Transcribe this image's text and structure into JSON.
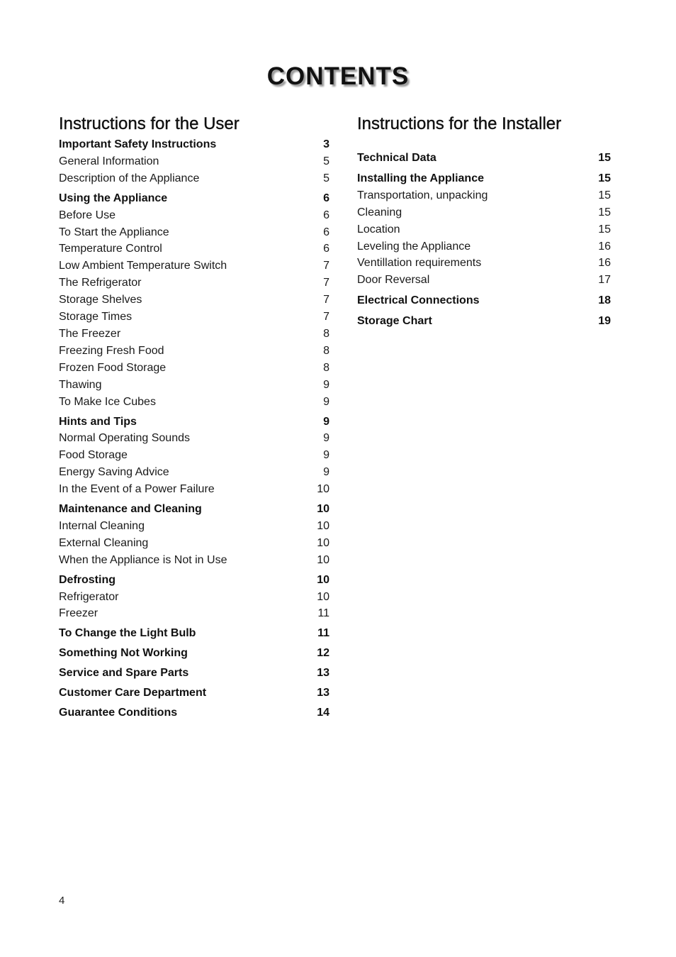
{
  "title": "CONTENTS",
  "user_section": {
    "heading": "Instructions for the User",
    "entries": [
      {
        "label": "Important Safety Instructions",
        "page": "3",
        "bold": true
      },
      {
        "label": "General Information",
        "page": "5",
        "bold": false
      },
      {
        "label": "Description of the Appliance",
        "page": "5",
        "bold": false
      },
      {
        "label": "Using the Appliance",
        "page": "6",
        "bold": true
      },
      {
        "label": "Before Use",
        "page": "6",
        "bold": false
      },
      {
        "label": "To Start the Appliance",
        "page": "6",
        "bold": false
      },
      {
        "label": "Temperature Control",
        "page": "6",
        "bold": false
      },
      {
        "label": "Low Ambient Temperature Switch",
        "page": "7",
        "bold": false
      },
      {
        "label": "The Refrigerator",
        "page": "7",
        "bold": false
      },
      {
        "label": "Storage Shelves",
        "page": "7",
        "bold": false
      },
      {
        "label": "Storage Times",
        "page": "7",
        "bold": false
      },
      {
        "label": "The Freezer",
        "page": "8",
        "bold": false
      },
      {
        "label": "Freezing Fresh Food",
        "page": "8",
        "bold": false
      },
      {
        "label": "Frozen Food Storage",
        "page": "8",
        "bold": false
      },
      {
        "label": "Thawing",
        "page": "9",
        "bold": false
      },
      {
        "label": "To Make Ice Cubes",
        "page": "9",
        "bold": false
      },
      {
        "label": "Hints and Tips",
        "page": "9",
        "bold": true
      },
      {
        "label": "Normal Operating Sounds",
        "page": "9",
        "bold": false
      },
      {
        "label": "Food Storage",
        "page": "9",
        "bold": false
      },
      {
        "label": "Energy Saving Advice",
        "page": "9",
        "bold": false
      },
      {
        "label": "In the Event of a Power Failure",
        "page": "10",
        "bold": false
      },
      {
        "label": "Maintenance and Cleaning",
        "page": "10",
        "bold": true
      },
      {
        "label": "Internal Cleaning",
        "page": "10",
        "bold": false
      },
      {
        "label": "External Cleaning",
        "page": "10",
        "bold": false
      },
      {
        "label": "When the Appliance is Not in Use",
        "page": "10",
        "bold": false
      },
      {
        "label": "Defrosting",
        "page": "10",
        "bold": true
      },
      {
        "label": "Refrigerator",
        "page": "10",
        "bold": false
      },
      {
        "label": "Freezer",
        "page": "11",
        "bold": false
      },
      {
        "label": "To Change the Light Bulb",
        "page": "11",
        "bold": true
      },
      {
        "label": "Something Not Working",
        "page": "12",
        "bold": true
      },
      {
        "label": "Service and Spare Parts",
        "page": "13",
        "bold": true
      },
      {
        "label": "Customer Care Department",
        "page": "13",
        "bold": true
      },
      {
        "label": "Guarantee Conditions",
        "page": "14",
        "bold": true
      }
    ]
  },
  "installer_section": {
    "heading": "Instructions for the Installer",
    "entries": [
      {
        "label": "Technical Data",
        "page": "15",
        "bold": true
      },
      {
        "label": "Installing the Appliance",
        "page": "15",
        "bold": true
      },
      {
        "label": "Transportation, unpacking",
        "page": "15",
        "bold": false
      },
      {
        "label": "Cleaning",
        "page": "15",
        "bold": false
      },
      {
        "label": "Location",
        "page": "15",
        "bold": false
      },
      {
        "label": "Leveling the Appliance",
        "page": "16",
        "bold": false
      },
      {
        "label": "Ventillation requirements",
        "page": "16",
        "bold": false
      },
      {
        "label": "Door Reversal",
        "page": "17",
        "bold": false
      },
      {
        "label": "Electrical Connections",
        "page": "18",
        "bold": true
      },
      {
        "label": "Storage Chart",
        "page": "19",
        "bold": true
      }
    ]
  },
  "page_number": "4"
}
